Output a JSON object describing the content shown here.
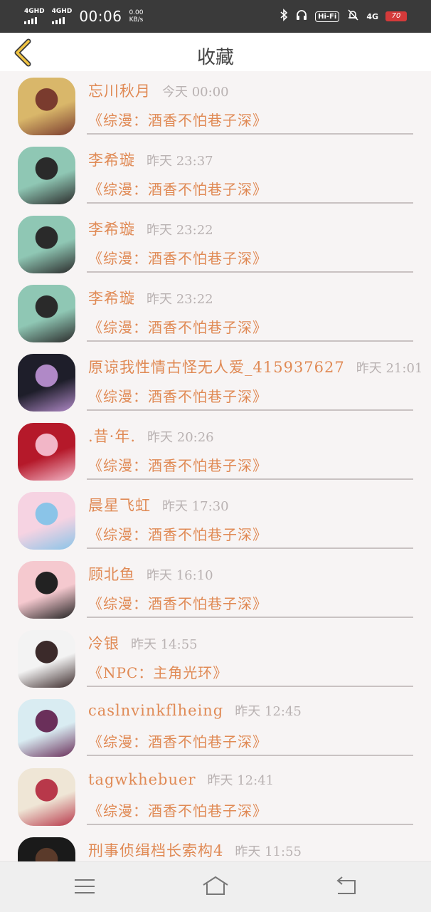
{
  "status": {
    "sim1": "4GHD",
    "sim2": "4GHD",
    "time": "00:06",
    "speed_value": "0.00",
    "speed_unit": "KB/s",
    "hifi": "Hi-Fi",
    "net": "4G",
    "battery": "70"
  },
  "header": {
    "title": "收藏"
  },
  "items": [
    {
      "name": "忘川秋月",
      "time": "今天 00:00",
      "book": "《综漫：酒香不怕巷子深》",
      "avatar_colors": [
        "#d9b76a",
        "#7a3b2e"
      ]
    },
    {
      "name": "李希璇",
      "time": "昨天 23:37",
      "book": "《综漫：酒香不怕巷子深》",
      "avatar_colors": [
        "#8fc7b4",
        "#2a2a2a"
      ]
    },
    {
      "name": "李希璇",
      "time": "昨天 23:22",
      "book": "《综漫：酒香不怕巷子深》",
      "avatar_colors": [
        "#8fc7b4",
        "#2a2a2a"
      ]
    },
    {
      "name": "李希璇",
      "time": "昨天 23:22",
      "book": "《综漫：酒香不怕巷子深》",
      "avatar_colors": [
        "#8fc7b4",
        "#2a2a2a"
      ]
    },
    {
      "name": "原谅我性情古怪无人爱_415937627",
      "time": "昨天 21:01",
      "book": "《综漫：酒香不怕巷子深》",
      "avatar_colors": [
        "#1e1e2a",
        "#b089c7"
      ]
    },
    {
      "name": ".昔·年.",
      "time": "昨天 20:26",
      "book": "《综漫：酒香不怕巷子深》",
      "avatar_colors": [
        "#b5192a",
        "#f2b6c7"
      ]
    },
    {
      "name": "晨星飞虹",
      "time": "昨天 17:30",
      "book": "《综漫：酒香不怕巷子深》",
      "avatar_colors": [
        "#f6d3e2",
        "#8ac4e8"
      ]
    },
    {
      "name": "顾北鱼",
      "time": "昨天 16:10",
      "book": "《综漫：酒香不怕巷子深》",
      "avatar_colors": [
        "#f5c9cf",
        "#222222"
      ]
    },
    {
      "name": "冷银",
      "time": "昨天 14:55",
      "book": "《NPC：主角光环》",
      "avatar_colors": [
        "#f3f3f3",
        "#3b2a2a"
      ]
    },
    {
      "name": "caslnvinkflheing",
      "time": "昨天 12:45",
      "book": "《综漫：酒香不怕巷子深》",
      "avatar_colors": [
        "#d9ecf2",
        "#6a2f5a"
      ]
    },
    {
      "name": "tagwkhebuer",
      "time": "昨天 12:41",
      "book": "《综漫：酒香不怕巷子深》",
      "avatar_colors": [
        "#efe6d6",
        "#b8384a"
      ]
    },
    {
      "name": "刑事侦缉档长索构4",
      "time": "昨天 11:55",
      "book": "",
      "avatar_colors": [
        "#1a1a1a",
        "#5a3a2a"
      ]
    }
  ]
}
